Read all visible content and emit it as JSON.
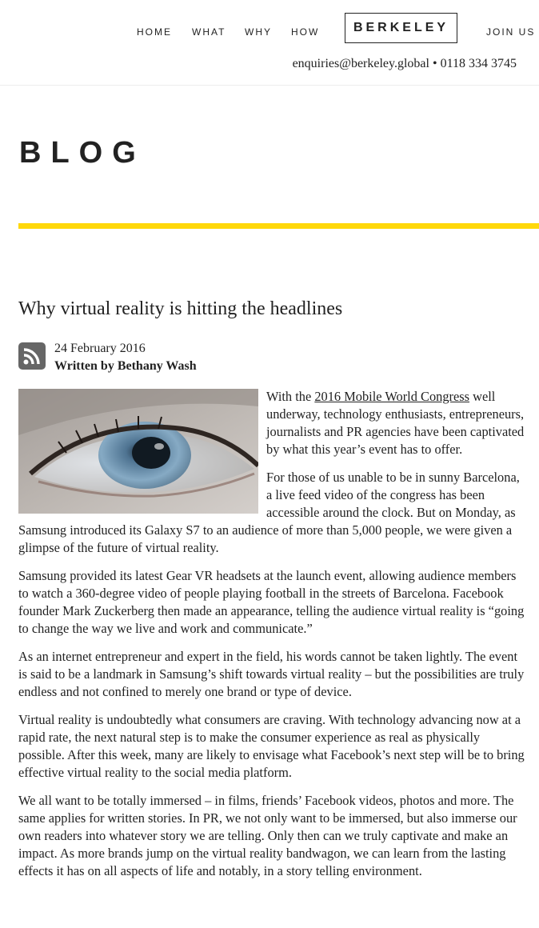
{
  "nav": {
    "items": [
      "HOME",
      "WHAT",
      "WHY",
      "HOW"
    ],
    "logo": "BERKELEY",
    "join": "JOIN US"
  },
  "contact": {
    "email": "enquiries@berkeley.global",
    "separator": "•",
    "phone": "0118 334 3745"
  },
  "page_title": "BLOG",
  "accent_color": "#ffd80a",
  "post": {
    "title": "Why virtual reality is hitting the headlines",
    "date": "24 February 2016",
    "author": "Written by Bethany Wash",
    "icon": "rss-icon",
    "p1_before": "With the ",
    "p1_link": "2016 Mobile World Congress",
    "p1_after": " well underway, technology enthusiasts, entrepreneurs, journalists and PR agencies have been captivated by what this year’s event has to offer.",
    "p2": "For those of us unable to be in sunny Barcelona, a live feed video of the congress has been accessible around the clock. But on Monday, as Samsung introduced its Galaxy S7 to an audience of more than 5,000 people, we were given a glimpse of the future of virtual reality.",
    "p3": "Samsung provided its latest Gear VR headsets at the launch event, allowing audience members to watch a 360-degree video of people playing football in the streets of Barcelona. Facebook founder Mark Zuckerberg then made an appearance, telling the audience virtual reality is “going to change the way we live and work and communicate.”",
    "p4": "As an internet entrepreneur and expert in the field, his words cannot be taken lightly. The event is said to be a landmark in Samsung’s shift towards virtual reality – but the possibilities are truly endless and not confined to merely one brand or type of device.",
    "p5": "Virtual reality is undoubtedly what consumers are craving. With technology advancing now at a rapid rate, the next natural step is to make the consumer experience as real as physically possible. After this week, many are likely to envisage what Facebook’s next step will be to bring effective virtual reality to the social media platform.",
    "p6": "We all want to be totally immersed – in films, friends’ Facebook videos, photos and more. The same applies for written stories. In PR, we not only want to be immersed, but also immerse our own readers into whatever story we are telling. Only then can we truly captivate and make an impact. As more brands jump on the virtual reality bandwagon, we can learn from the lasting effects it has on all aspects of life and notably, in a story telling environment."
  }
}
